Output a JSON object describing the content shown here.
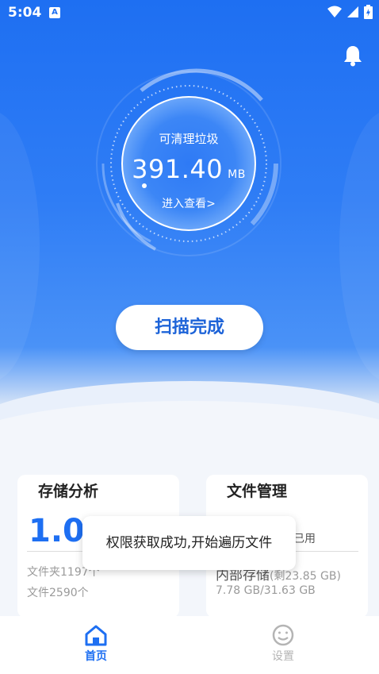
{
  "status_bar": {
    "time": "5:04",
    "app_icon_letter": "A",
    "icons": [
      "wifi-icon",
      "signal-icon",
      "battery-icon"
    ]
  },
  "header": {
    "bell_icon": "bell-icon"
  },
  "gauge": {
    "label": "可清理垃圾",
    "value": "391.40",
    "unit": "MB",
    "enter_label": "进入查看>"
  },
  "scan_button": {
    "label": "扫描完成"
  },
  "storage_card": {
    "title": "存储分析",
    "big_value": "1.0",
    "folders": "文件夹1197个",
    "files": "文件2590个"
  },
  "file_card": {
    "title": "文件管理",
    "used_label": "已用",
    "internal_label": "内部存储",
    "remaining": "(剩23.85 GB)",
    "usage": "7.78 GB/31.63 GB"
  },
  "toast": {
    "message": "权限获取成功,开始遍历文件"
  },
  "nav": {
    "home_label": "首页",
    "settings_label": "设置"
  },
  "colors": {
    "primary": "#1e6ff2",
    "primary_light": "#74a8f8",
    "inactive": "#b4b4b4"
  }
}
